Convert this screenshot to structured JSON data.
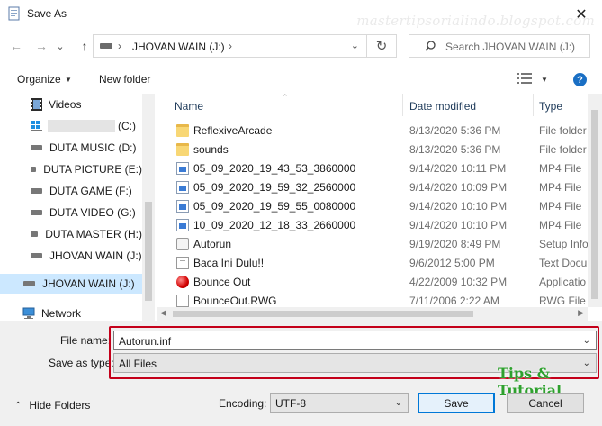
{
  "window": {
    "title": "Save As",
    "watermark": "mastertipsorialindo.blogspot.com",
    "close_glyph": "✕"
  },
  "nav": {
    "back_glyph": "←",
    "forward_glyph": "→",
    "dropdown_glyph": "⌄",
    "up_glyph": "↑",
    "breadcrumb": "JHOVAN WAIN (J:)",
    "separator": "›",
    "refresh_glyph": "↻",
    "search_placeholder": "Search JHOVAN WAIN (J:)"
  },
  "toolbar": {
    "organize": "Organize",
    "new_folder": "New folder",
    "help": "?"
  },
  "sidebar": {
    "items": [
      {
        "label": "Videos",
        "icon": "videos-icon"
      },
      {
        "label": "(C:)",
        "icon": "windows-drive-icon"
      },
      {
        "label": "DUTA MUSIC (D:)",
        "icon": "drive-icon"
      },
      {
        "label": "DUTA PICTURE (E:)",
        "icon": "drive-icon"
      },
      {
        "label": "DUTA GAME (F:)",
        "icon": "drive-icon"
      },
      {
        "label": "DUTA VIDEO (G:)",
        "icon": "drive-icon"
      },
      {
        "label": "DUTA MASTER (H:)",
        "icon": "drive-icon"
      },
      {
        "label": "JHOVAN WAIN (J:)",
        "icon": "drive-icon"
      },
      {
        "label": "JHOVAN WAIN (J:)",
        "icon": "drive-icon",
        "selected": true
      },
      {
        "label": "Network",
        "icon": "network-icon"
      }
    ]
  },
  "columns": {
    "name": "Name",
    "date": "Date modified",
    "type": "Type"
  },
  "files": [
    {
      "name": "ReflexiveArcade",
      "date": "8/13/2020 5:36 PM",
      "type": "File folder",
      "icon": "folder"
    },
    {
      "name": "sounds",
      "date": "8/13/2020 5:36 PM",
      "type": "File folder",
      "icon": "folder"
    },
    {
      "name": "05_09_2020_19_43_53_3860000",
      "date": "9/14/2020 10:11 PM",
      "type": "MP4 File",
      "icon": "mp4"
    },
    {
      "name": "05_09_2020_19_59_32_2560000",
      "date": "9/14/2020 10:09 PM",
      "type": "MP4 File",
      "icon": "mp4"
    },
    {
      "name": "05_09_2020_19_59_55_0080000",
      "date": "9/14/2020 10:10 PM",
      "type": "MP4 File",
      "icon": "mp4"
    },
    {
      "name": "10_09_2020_12_18_33_2660000",
      "date": "9/14/2020 10:10 PM",
      "type": "MP4 File",
      "icon": "mp4"
    },
    {
      "name": "Autorun",
      "date": "9/19/2020 8:49 PM",
      "type": "Setup Info",
      "icon": "setup"
    },
    {
      "name": "Baca Ini Dulu!!",
      "date": "9/6/2012 5:00 PM",
      "type": "Text Docu",
      "icon": "doc"
    },
    {
      "name": "Bounce Out",
      "date": "4/22/2009 10:32 PM",
      "type": "Applicatio",
      "icon": "bounce"
    },
    {
      "name": "BounceOut.RWG",
      "date": "7/11/2006 2:22 AM",
      "type": "RWG File",
      "icon": "rwg"
    }
  ],
  "form": {
    "file_name_label": "File name:",
    "file_name_value": "Autorun.inf",
    "save_type_label": "Save as type:",
    "save_type_value": "All Files",
    "hide_folders": "Hide Folders",
    "encoding_label": "Encoding:",
    "encoding_value": "UTF-8",
    "save": "Save",
    "cancel": "Cancel",
    "drop_glyph": "⌄",
    "caret_glyph": "⌃"
  },
  "overlay": {
    "tips_text": "Tips & Tutorial",
    "accent": "#c4001a"
  }
}
